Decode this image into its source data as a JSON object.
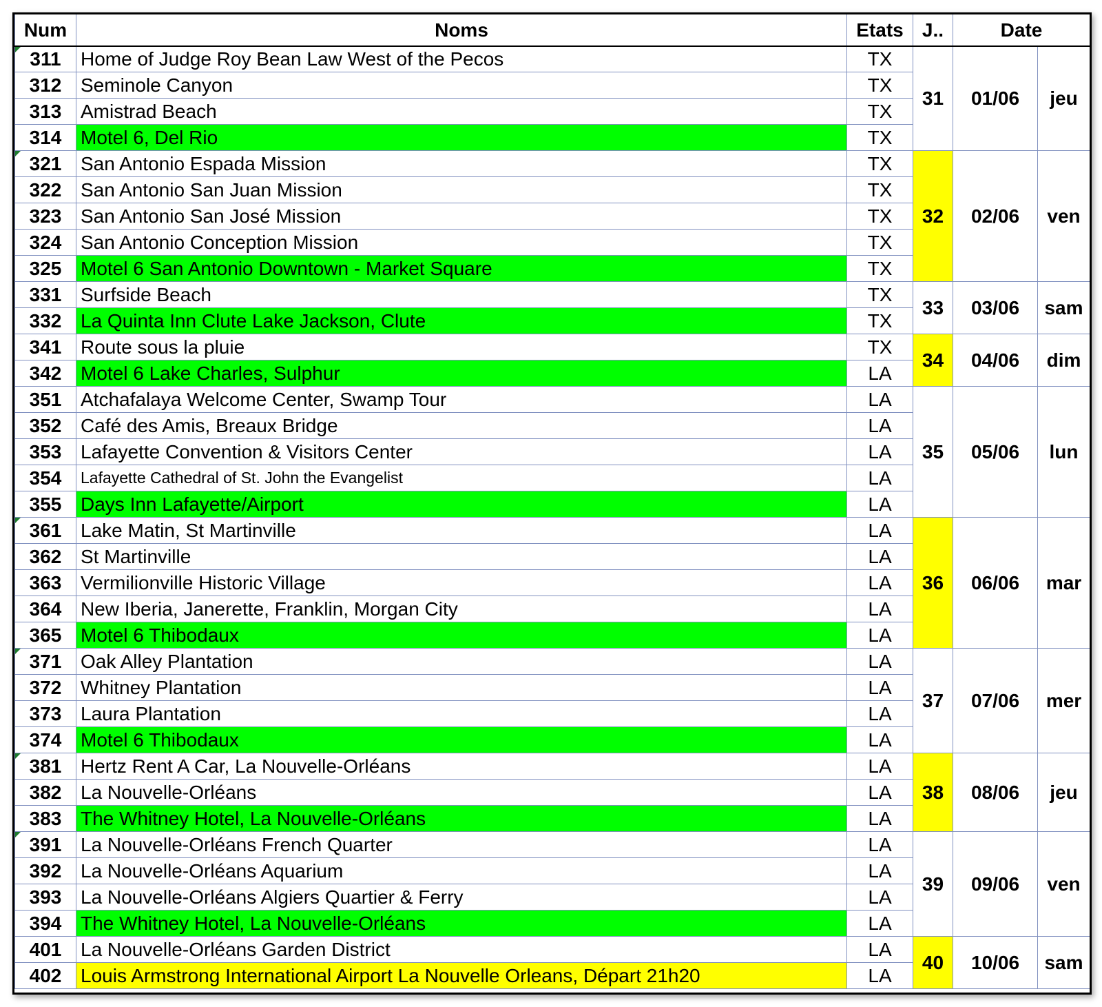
{
  "headers": {
    "num": "Num",
    "noms": "Noms",
    "etats": "Etats",
    "jour": "J..",
    "date": "Date"
  },
  "rows": [
    {
      "num": "311",
      "nom": "Home of Judge Roy Bean Law West of the Pecos",
      "etat": "TX",
      "style": "",
      "mark": true
    },
    {
      "num": "312",
      "nom": "Seminole Canyon",
      "etat": "TX",
      "style": ""
    },
    {
      "num": "313",
      "nom": "Amistrad Beach",
      "etat": "TX",
      "style": ""
    },
    {
      "num": "314",
      "nom": "Motel 6, Del Rio",
      "etat": "TX",
      "style": "green"
    },
    {
      "num": "321",
      "nom": "San Antonio Espada Mission",
      "etat": "TX",
      "style": "",
      "mark": true
    },
    {
      "num": "322",
      "nom": "San Antonio San Juan Mission",
      "etat": "TX",
      "style": ""
    },
    {
      "num": "323",
      "nom": "San Antonio San José Mission",
      "etat": "TX",
      "style": ""
    },
    {
      "num": "324",
      "nom": "San Antonio Conception Mission",
      "etat": "TX",
      "style": ""
    },
    {
      "num": "325",
      "nom": "Motel 6 San Antonio Downtown - Market Square",
      "etat": "TX",
      "style": "green"
    },
    {
      "num": "331",
      "nom": "Surfside Beach",
      "etat": "TX",
      "style": ""
    },
    {
      "num": "332",
      "nom": "La Quinta Inn Clute Lake Jackson, Clute",
      "etat": "TX",
      "style": "green"
    },
    {
      "num": "341",
      "nom": "Route sous la pluie",
      "etat": "TX",
      "style": ""
    },
    {
      "num": "342",
      "nom": "Motel 6 Lake Charles, Sulphur",
      "etat": "LA",
      "style": "green"
    },
    {
      "num": "351",
      "nom": "Atchafalaya Welcome Center, Swamp Tour",
      "etat": "LA",
      "style": ""
    },
    {
      "num": "352",
      "nom": "Café des Amis, Breaux Bridge",
      "etat": "LA",
      "style": ""
    },
    {
      "num": "353",
      "nom": "Lafayette Convention & Visitors Center",
      "etat": "LA",
      "style": ""
    },
    {
      "num": "354",
      "nom": "Lafayette Cathedral of St. John the Evangelist",
      "etat": "LA",
      "style": "small"
    },
    {
      "num": "355",
      "nom": "Days Inn Lafayette/Airport",
      "etat": "LA",
      "style": "green"
    },
    {
      "num": "361",
      "nom": "Lake Matin, St Martinville",
      "etat": "LA",
      "style": "",
      "mark": true
    },
    {
      "num": "362",
      "nom": "St Martinville",
      "etat": "LA",
      "style": ""
    },
    {
      "num": "363",
      "nom": "Vermilionville Historic Village",
      "etat": "LA",
      "style": ""
    },
    {
      "num": "364",
      "nom": "New Iberia, Janerette, Franklin, Morgan City",
      "etat": "LA",
      "style": ""
    },
    {
      "num": "365",
      "nom": "Motel 6 Thibodaux",
      "etat": "LA",
      "style": "green"
    },
    {
      "num": "371",
      "nom": "Oak Alley Plantation",
      "etat": "LA",
      "style": "",
      "mark": true
    },
    {
      "num": "372",
      "nom": "Whitney Plantation",
      "etat": "LA",
      "style": ""
    },
    {
      "num": "373",
      "nom": "Laura Plantation",
      "etat": "LA",
      "style": ""
    },
    {
      "num": "374",
      "nom": "Motel 6 Thibodaux",
      "etat": "LA",
      "style": "green"
    },
    {
      "num": "381",
      "nom": "Hertz Rent A Car, La Nouvelle-Orléans",
      "etat": "LA",
      "style": "",
      "mark": true
    },
    {
      "num": "382",
      "nom": "La Nouvelle-Orléans",
      "etat": "LA",
      "style": ""
    },
    {
      "num": "383",
      "nom": "The Whitney Hotel, La Nouvelle-Orléans",
      "etat": "LA",
      "style": "green"
    },
    {
      "num": "391",
      "nom": "La Nouvelle-Orléans French Quarter",
      "etat": "LA",
      "style": "",
      "mark": true
    },
    {
      "num": "392",
      "nom": "La Nouvelle-Orléans Aquarium",
      "etat": "LA",
      "style": ""
    },
    {
      "num": "393",
      "nom": "La Nouvelle-Orléans Algiers Quartier & Ferry",
      "etat": "LA",
      "style": ""
    },
    {
      "num": "394",
      "nom": "The Whitney Hotel, La Nouvelle-Orléans",
      "etat": "LA",
      "style": "green"
    },
    {
      "num": "401",
      "nom": "La Nouvelle-Orléans Garden District",
      "etat": "LA",
      "style": ""
    },
    {
      "num": "402",
      "nom": "Louis Armstrong International Airport La Nouvelle Orleans, Départ 21h20",
      "etat": "LA",
      "style": "yellow"
    }
  ],
  "days": [
    {
      "jour": "31",
      "date": "01/06",
      "wd": "jeu",
      "span": 4,
      "highlight": false
    },
    {
      "jour": "32",
      "date": "02/06",
      "wd": "ven",
      "span": 5,
      "highlight": true
    },
    {
      "jour": "33",
      "date": "03/06",
      "wd": "sam",
      "span": 2,
      "highlight": false
    },
    {
      "jour": "34",
      "date": "04/06",
      "wd": "dim",
      "span": 2,
      "highlight": true
    },
    {
      "jour": "35",
      "date": "05/06",
      "wd": "lun",
      "span": 5,
      "highlight": false
    },
    {
      "jour": "36",
      "date": "06/06",
      "wd": "mar",
      "span": 5,
      "highlight": true
    },
    {
      "jour": "37",
      "date": "07/06",
      "wd": "mer",
      "span": 4,
      "highlight": false
    },
    {
      "jour": "38",
      "date": "08/06",
      "wd": "jeu",
      "span": 3,
      "highlight": true
    },
    {
      "jour": "39",
      "date": "09/06",
      "wd": "ven",
      "span": 4,
      "highlight": false
    },
    {
      "jour": "40",
      "date": "10/06",
      "wd": "sam",
      "span": 2,
      "highlight": true
    }
  ],
  "colors": {
    "green": "#00ff00",
    "yellow": "#ffff00",
    "grid": "#7f8fbf",
    "comment_marker": "#1e7b2e"
  }
}
